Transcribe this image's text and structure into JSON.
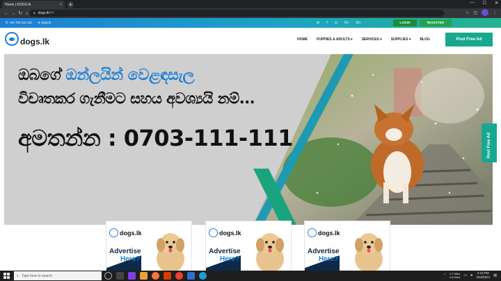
{
  "browser": {
    "tab_title": "Home | DOGS.lk",
    "tab_close": "×",
    "new_tab": "+",
    "url_host": "dogs.lk",
    "url_path": "/#!/",
    "back": "←",
    "forward": "→",
    "reload": "↻",
    "home": "⌂"
  },
  "topbar": {
    "phone": "+94 703-111-111",
    "telegram": "dogs.lk",
    "social": [
      "⊕",
      "f",
      "◎",
      "G+",
      "En"
    ],
    "login": "LOGIN",
    "register": "REGISTER"
  },
  "site": {
    "logo_text": "dogs.lk",
    "nav": [
      "HOME",
      "PUPPIES & ADULTS ▾",
      "SERVICES ▾",
      "SUPPLIES ▾",
      "BLOG"
    ],
    "post_ad": "Post Free Ad",
    "side_post_ad": "Post Free Ad"
  },
  "hero": {
    "line1_a": "ඔබගේ ",
    "line1_b": "ඔන්ලයින් වෙළඳසැල",
    "line2": "විචෘතකර ගැනීමට සහය අවශ්‍යයි නම්...",
    "call_label": "අමතන්න : ",
    "call_number": "0703-111-111"
  },
  "cards": [
    {
      "logo": "dogs.lk",
      "advertise": "Advertise",
      "here": "Here?"
    },
    {
      "logo": "dogs.lk",
      "advertise": "Advertise",
      "here": "Here?"
    },
    {
      "logo": "dogs.lk",
      "advertise": "Advertise",
      "here": "Here?"
    }
  ],
  "taskbar": {
    "search_placeholder": "Type here to search",
    "net_up": "0.7 KB/s",
    "net_down": "0.8 KB/s",
    "time": "2:13 PM",
    "date": "4/23/2021"
  },
  "colors": {
    "accent_blue": "#1e7fd6",
    "accent_teal": "#17a890",
    "login_green": "#1c8d3a"
  }
}
